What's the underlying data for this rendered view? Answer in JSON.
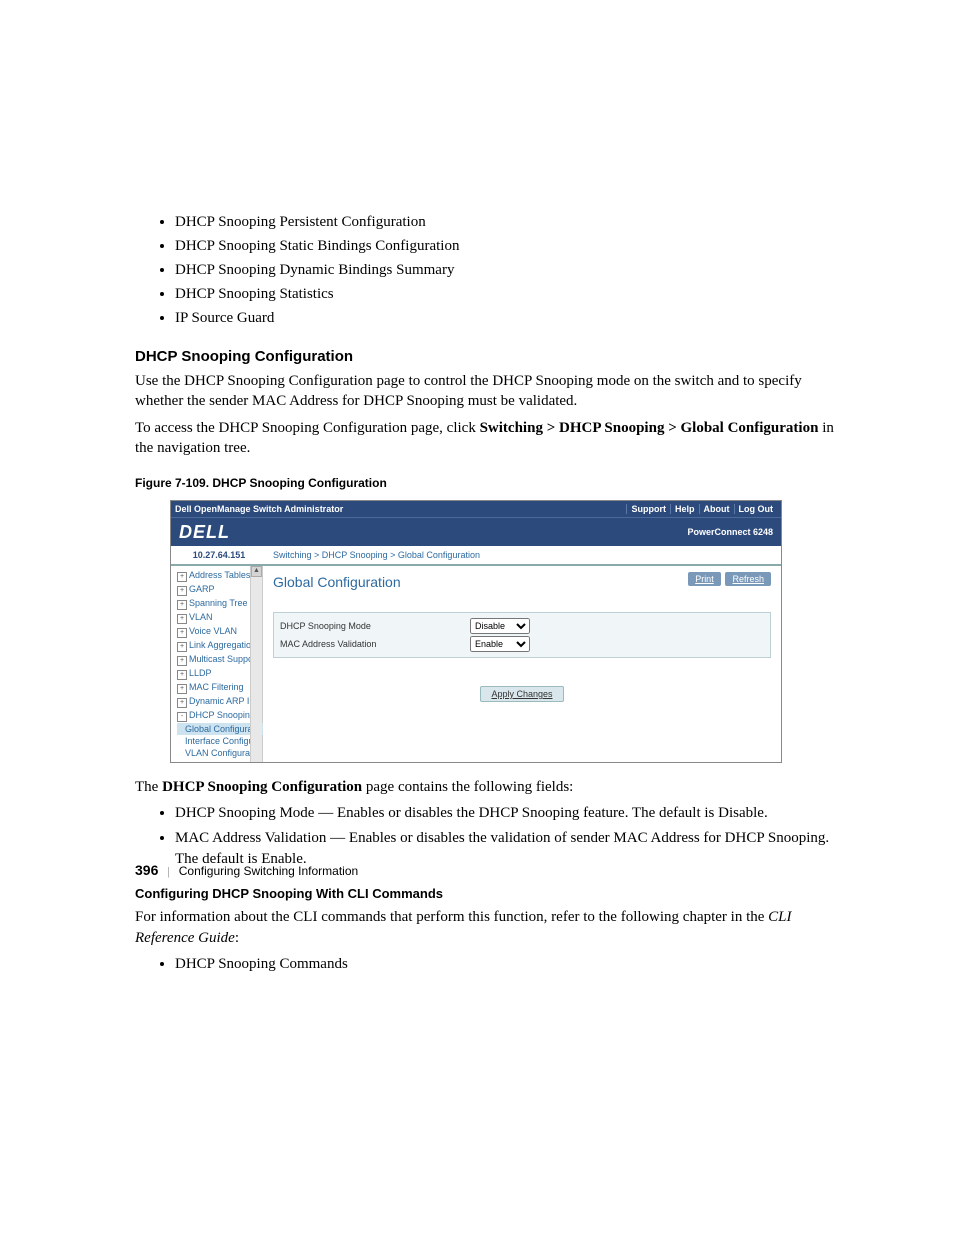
{
  "top_items": [
    "DHCP Snooping Persistent Configuration",
    "DHCP Snooping Static Bindings Configuration",
    "DHCP Snooping Dynamic Bindings Summary",
    "DHCP Snooping Statistics",
    "IP Source Guard"
  ],
  "section": {
    "heading": "DHCP Snooping Configuration",
    "para1": "Use the DHCP Snooping Configuration page to control the DHCP Snooping mode on the switch and to specify whether the sender MAC Address for DHCP Snooping must be validated.",
    "para2_a": "To access the DHCP Snooping Configuration page, click ",
    "para2_b": "Switching > DHCP Snooping > Global Configuration",
    "para2_c": " in the navigation tree."
  },
  "figure_caption": "Figure 7-109.    DHCP Snooping Configuration",
  "shot": {
    "titlebar": {
      "title": "Dell OpenManage Switch Administrator",
      "links": [
        "Support",
        "Help",
        "About",
        "Log Out"
      ]
    },
    "brand": {
      "logo": "DELL",
      "product": "PowerConnect 6248"
    },
    "ip": "10.27.64.151",
    "breadcrumb": "Switching > DHCP Snooping > Global Configuration",
    "tree": [
      {
        "label": "Address Tables",
        "t": "+"
      },
      {
        "label": "GARP",
        "t": "+"
      },
      {
        "label": "Spanning Tree",
        "t": "+"
      },
      {
        "label": "VLAN",
        "t": "+"
      },
      {
        "label": "Voice VLAN",
        "t": "+"
      },
      {
        "label": "Link Aggregation",
        "t": "+"
      },
      {
        "label": "Multicast Support",
        "t": "+"
      },
      {
        "label": "LLDP",
        "t": "+"
      },
      {
        "label": "MAC Filtering",
        "t": "+"
      },
      {
        "label": "Dynamic ARP Inspe",
        "t": "+"
      },
      {
        "label": "DHCP Snooping",
        "t": "-"
      },
      {
        "label": "Global Configurat",
        "sub": true,
        "sel": true
      },
      {
        "label": "Interface Configu",
        "sub": true
      },
      {
        "label": "VLAN Configurat",
        "sub": true
      }
    ],
    "panel": {
      "title": "Global Configuration",
      "print": "Print",
      "refresh": "Refresh",
      "rows": [
        {
          "label": "DHCP Snooping Mode",
          "value": "Disable"
        },
        {
          "label": "MAC Address Validation",
          "value": "Enable"
        }
      ],
      "apply": "Apply Changes"
    }
  },
  "after_fig": {
    "lead_a": "The ",
    "lead_b": "DHCP Snooping Configuration",
    "lead_c": " page contains the following fields:"
  },
  "fields": [
    {
      "name": "DHCP Snooping Mode",
      "rest": " — Enables or disables the DHCP Snooping feature. The default is Disable."
    },
    {
      "name": "MAC Address Validation",
      "rest": " — Enables or disables the validation of sender MAC Address for DHCP Snooping. The default is Enable."
    }
  ],
  "cli_head": "Configuring DHCP Snooping With CLI Commands",
  "cli_para_a": "For information about the CLI commands that perform this function, refer to the following chapter in the ",
  "cli_para_b": "CLI Reference Guide",
  "cli_para_c": ":",
  "cli_items": [
    "DHCP Snooping Commands"
  ],
  "footer": {
    "page": "396",
    "section": "Configuring Switching Information"
  }
}
